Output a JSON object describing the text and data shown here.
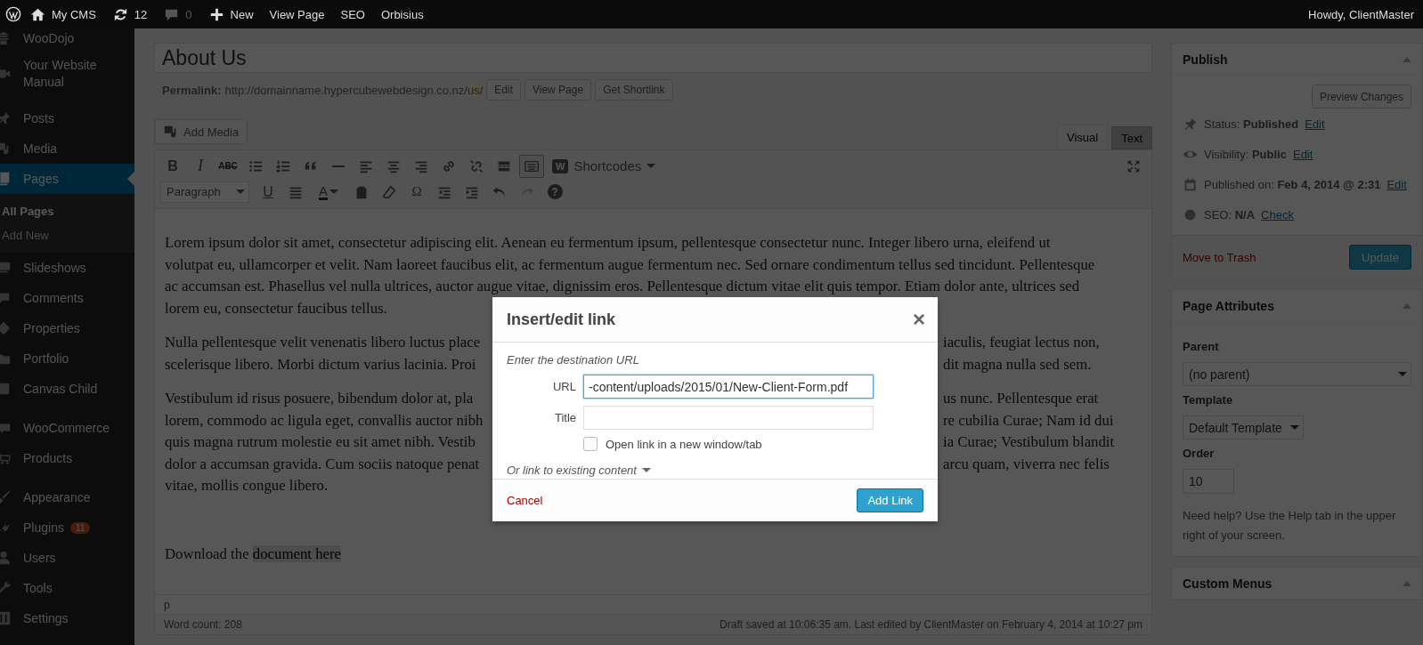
{
  "topbar": {
    "items": [
      {
        "label": "My CMS",
        "dim": false
      },
      {
        "label": "12",
        "dim": false
      },
      {
        "label": "0",
        "dim": true
      },
      {
        "label": "New",
        "dim": false
      },
      {
        "label": "View Page",
        "dim": false
      },
      {
        "label": "SEO",
        "dim": false
      },
      {
        "label": "Orbisius",
        "dim": false
      }
    ],
    "greeting": "Howdy, ClientMaster"
  },
  "sidebar": {
    "groups": [
      [
        {
          "label": "WooDojo",
          "selected": false
        },
        {
          "label": "Your Website Manual",
          "selected": false
        }
      ],
      [
        {
          "label": "Posts",
          "selected": false
        },
        {
          "label": "Media",
          "selected": false
        },
        {
          "label": "Pages",
          "selected": true,
          "children": [
            {
              "label": "All Pages",
              "selected": true
            },
            {
              "label": "Add New",
              "selected": false
            }
          ]
        },
        {
          "label": "Slideshows",
          "selected": false
        },
        {
          "label": "Comments",
          "selected": false
        },
        {
          "label": "Properties",
          "selected": false
        },
        {
          "label": "Portfolio",
          "selected": false
        },
        {
          "label": "Canvas Child",
          "selected": false
        }
      ],
      [
        {
          "label": "WooCommerce",
          "selected": false
        },
        {
          "label": "Products",
          "selected": false
        }
      ],
      [
        {
          "label": "Appearance",
          "selected": false
        },
        {
          "label": "Plugins",
          "selected": false,
          "badge": "11"
        },
        {
          "label": "Users",
          "selected": false
        },
        {
          "label": "Tools",
          "selected": false
        },
        {
          "label": "Settings",
          "selected": false
        }
      ]
    ]
  },
  "editor": {
    "title": "About Us",
    "permalink": {
      "label": "Permalink:",
      "base": "http://domainname.hypercubewebdesign.co.nz/",
      "slug": "us",
      "tail": "/",
      "buttons": [
        "Edit",
        "View Page",
        "Get Shortlink"
      ]
    },
    "add_media": "Add Media",
    "tabs": [
      {
        "label": "Visual",
        "selected": true
      },
      {
        "label": "Text",
        "selected": false
      }
    ],
    "toolbar": {
      "bold": "B",
      "italic": "I",
      "strike": "ABC",
      "shortcodes_logo": "W",
      "shortcodes": "Shortcodes",
      "toggle_pressed": true,
      "format": "Paragraph",
      "underline": "U",
      "text_color": "A",
      "special_char": "Ω",
      "help": "?",
      "redo_disabled": true
    },
    "paragraphs": [
      {
        "kind": "split",
        "lines": [
          {
            "left": "Lorem ipsum dolor sit amet, consectetur adipiscing elit. Aenean eu fermentum ipsum, pellentesque consectetur nunc. Integer libero urna, eleifend ut"
          },
          {
            "left": "volutpat eu, ullamcorper et velit. Nam laoreet faucibus elit, ac fermentum augue fermentum nec. Sed ornare condimentum tellus sed tincidunt. Pellentesque"
          },
          {
            "left": "ac accumsan est. Phasellus vel nulla ultrices, auctor augue vitae, dignissim eros. Pellentesque dictum vitae elit quis tempor. Etiam dolor ante, ultrices sed"
          },
          {
            "left": "lorem eu, consectetur faucibus tellus."
          }
        ]
      },
      {
        "kind": "split",
        "lines": [
          {
            "left": "Nulla pellentesque velit venenatis libero luctus place",
            "right": "iaculis, feugiat lectus non,"
          },
          {
            "left": "scelerisque libero. Morbi dictum varius lacinia. Proi",
            "right": "dit magna nulla sed sem."
          }
        ]
      },
      {
        "kind": "split",
        "lines": [
          {
            "left": "Vestibulum id risus posuere, bibendum dolor at, pla",
            "right": "us nunc. Pellentesque erat"
          },
          {
            "left": "lorem, commodo ac ligula eget, convallis auctor nibh",
            "right": "re cubilia Curae; Nam id dui"
          },
          {
            "left": "quis magna rutrum molestie eu sit amet nibh. Vestib",
            "right": "ia Curae; Vestibulum blandit"
          },
          {
            "left": "dolor a accumsan gravida. Cum sociis natoque penat",
            "right": "arcu quam, viverra nec felis"
          },
          {
            "left": "vitae, mollis congue libero."
          }
        ]
      },
      {
        "kind": "download",
        "parts": [
          {
            "text": "Download the",
            "selected": false
          },
          {
            "text": "document here",
            "selected": true
          }
        ]
      }
    ],
    "path": "p",
    "word_count": "Word count: 208",
    "saved": "Draft saved at 10:06:35 am. Last edited by ClientMaster on February 4, 2014 at 10:27 pm"
  },
  "publish": {
    "title": "Publish",
    "preview": "Preview Changes",
    "rows": [
      {
        "text": "Status: **Published**",
        "link": "Edit"
      },
      {
        "text": "Visibility: **Public**",
        "link": "Edit"
      },
      {
        "text": "Published on: **Feb 4, 2014 @ 2:31**",
        "link": "Edit"
      },
      {
        "text": "SEO: **N/A**",
        "link": "Check"
      }
    ],
    "trash": "Move to Trash",
    "update": "Update"
  },
  "page_attributes": {
    "title": "Page Attributes",
    "parent_label": "Parent",
    "parent": "(no parent)",
    "template_label": "Template",
    "template": "Default Template",
    "order_label": "Order",
    "order": "10",
    "help": "Need help? Use the Help tab in the upper right of your screen."
  },
  "custom_menus": {
    "title": "Custom Menus"
  },
  "dialog": {
    "title": "Insert/edit link",
    "close": "×",
    "hint": "Enter the destination URL",
    "fields": [
      {
        "label": "URL",
        "value": "-content/uploads/2015/01/New-Client-Form.pdf",
        "focused": true
      },
      {
        "label": "Title",
        "focused": false
      }
    ],
    "new_tab": {
      "label": "Open link in a new window/tab",
      "checked": false
    },
    "existing": {
      "label": "Or link to existing content",
      "expanded": false
    },
    "cancel": "Cancel",
    "submit": "Add Link"
  }
}
